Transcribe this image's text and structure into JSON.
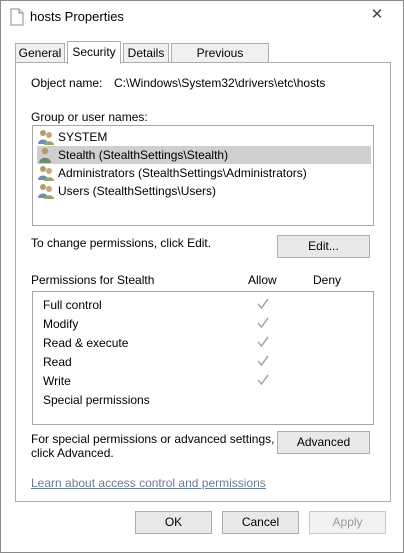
{
  "window": {
    "title": "hosts Properties",
    "close_glyph": "✕"
  },
  "tabs": [
    {
      "label": "General",
      "active": false
    },
    {
      "label": "Security",
      "active": true
    },
    {
      "label": "Details",
      "active": false
    },
    {
      "label": "Previous Versions",
      "active": false
    }
  ],
  "security": {
    "object_name_label": "Object name:",
    "object_name_value": "C:\\Windows\\System32\\drivers\\etc\\hosts",
    "group_label": "Group or user names:",
    "users": [
      {
        "name": "SYSTEM",
        "icon": "group-users-icon",
        "selected": false
      },
      {
        "name": "Stealth (StealthSettings\\Stealth)",
        "icon": "user-icon",
        "selected": true
      },
      {
        "name": "Administrators (StealthSettings\\Administrators)",
        "icon": "group-users-icon",
        "selected": false
      },
      {
        "name": "Users (StealthSettings\\Users)",
        "icon": "group-users-icon",
        "selected": false
      }
    ],
    "change_text": "To change permissions, click Edit.",
    "edit_button": "Edit...",
    "permissions_label": "Permissions for Stealth",
    "allow_header": "Allow",
    "deny_header": "Deny",
    "permissions": [
      {
        "name": "Full control",
        "allow": true,
        "deny": false
      },
      {
        "name": "Modify",
        "allow": true,
        "deny": false
      },
      {
        "name": "Read & execute",
        "allow": true,
        "deny": false
      },
      {
        "name": "Read",
        "allow": true,
        "deny": false
      },
      {
        "name": "Write",
        "allow": true,
        "deny": false
      },
      {
        "name": "Special permissions",
        "allow": false,
        "deny": false
      }
    ],
    "advanced_text_line1": "For special permissions or advanced settings,",
    "advanced_text_line2": "click Advanced.",
    "advanced_button": "Advanced",
    "learn_link": "Learn about access control and permissions"
  },
  "footer": {
    "ok": "OK",
    "cancel": "Cancel",
    "apply": "Apply"
  },
  "colors": {
    "selection": "#cfcfcf",
    "link": "#6a7c8f",
    "check": "#a8a8a8"
  }
}
